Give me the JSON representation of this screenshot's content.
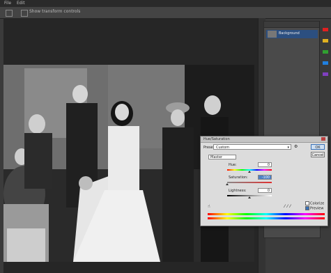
{
  "menu": [
    "File",
    "Edit"
  ],
  "options_bar": {
    "checkbox_label": "Show transform controls"
  },
  "layers_panel": {
    "layer_name": "Background"
  },
  "swatches": [
    "#e02020",
    "#e0b020",
    "#30a030",
    "#2080e0",
    "#8040c0"
  ],
  "dialog": {
    "title": "Hue/Saturation",
    "preset_label": "Preset:",
    "preset_value": "Custom",
    "ok_label": "OK",
    "cancel_label": "Cancel",
    "edit_value": "Master",
    "hue": {
      "label": "Hue:",
      "value": "0",
      "position": 0.5
    },
    "saturation": {
      "label": "Saturation:",
      "value": "-100",
      "position": 0.0
    },
    "lightness": {
      "label": "Lightness:",
      "value": "0",
      "position": 0.5
    },
    "colorize_label": "Colorize",
    "preview_label": "Preview",
    "preview_checked": true,
    "colorize_checked": false
  }
}
